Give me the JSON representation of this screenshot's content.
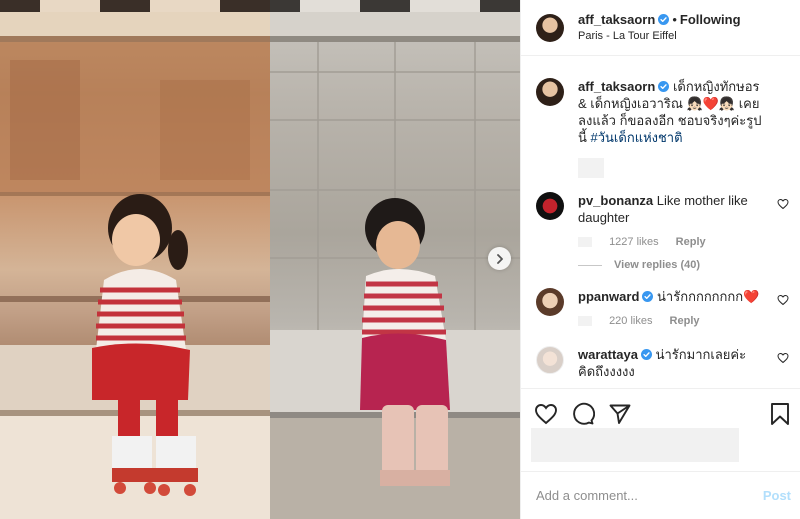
{
  "header": {
    "username": "aff_taksaorn",
    "separator": "•",
    "follow_label": "Following",
    "location": "Paris - La Tour Eiffel"
  },
  "caption": {
    "username": "aff_taksaorn",
    "text": "เด็กหญิงทักษอร & เด็กหญิงเอวาริณ 👧🏻❤️👧🏻 เคยลงแล้ว ก็ขอลงอีก ชอบจริงๆค่ะรูปนี้",
    "hashtag": "#วันเด็กแห่งชาติ"
  },
  "comments": [
    {
      "username": "pv_bonanza",
      "text": "Like mother like daughter",
      "likes": "1227 likes",
      "reply": "Reply",
      "view_replies": "View replies (40)"
    },
    {
      "username": "ppanward",
      "text": "น่ารักกกกกกกก❤️",
      "likes": "220 likes",
      "reply": "Reply"
    },
    {
      "username": "warattaya",
      "text": "น่ารักมากเลยค่ะ คิดถึงงงงง"
    }
  ],
  "add_comment": {
    "placeholder": "Add a comment...",
    "post_label": "Post"
  },
  "icons": [
    "heart-icon",
    "comment-icon",
    "share-icon",
    "bookmark-icon",
    "verified-badge-icon",
    "chevron-right-icon"
  ],
  "colors": {
    "verified": "#3897f0",
    "hashtag": "#00376b",
    "post_disabled": "#b2dffc",
    "meta_gray": "#8e8e8e"
  }
}
